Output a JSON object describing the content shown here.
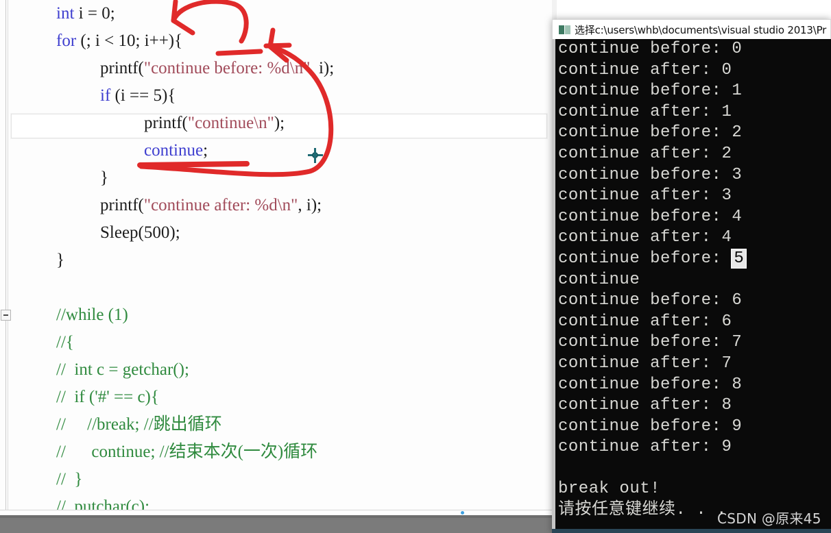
{
  "editor": {
    "name": "visual-studio-code-editor",
    "fold_marker": "−",
    "code_lines": [
      {
        "indent": 0,
        "tokens": [
          {
            "t": "int ",
            "c": "kw"
          },
          {
            "t": "i = 0;",
            "c": "pln"
          }
        ]
      },
      {
        "indent": 0,
        "tokens": [
          {
            "t": "for",
            "c": "kw"
          },
          {
            "t": " (; i < 10; i++){",
            "c": "pln"
          }
        ]
      },
      {
        "indent": 1,
        "tokens": [
          {
            "t": "printf(",
            "c": "pln"
          },
          {
            "t": "\"continue before: %d\\n\"",
            "c": "str"
          },
          {
            "t": ", i);",
            "c": "pln"
          }
        ]
      },
      {
        "indent": 1,
        "tokens": [
          {
            "t": "if",
            "c": "kw"
          },
          {
            "t": " (i == 5){",
            "c": "pln"
          }
        ]
      },
      {
        "indent": 2,
        "tokens": [
          {
            "t": "printf(",
            "c": "pln"
          },
          {
            "t": "\"continue\\n\"",
            "c": "str"
          },
          {
            "t": ");",
            "c": "pln"
          }
        ]
      },
      {
        "indent": 2,
        "tokens": [
          {
            "t": "continue",
            "c": "kw"
          },
          {
            "t": ";",
            "c": "pln"
          }
        ]
      },
      {
        "indent": 1,
        "tokens": [
          {
            "t": "}",
            "c": "pln"
          }
        ]
      },
      {
        "indent": 1,
        "tokens": [
          {
            "t": "printf(",
            "c": "pln"
          },
          {
            "t": "\"continue after: %d\\n\"",
            "c": "str"
          },
          {
            "t": ", i);",
            "c": "pln"
          }
        ]
      },
      {
        "indent": 1,
        "tokens": [
          {
            "t": "Sleep(500);",
            "c": "pln"
          }
        ]
      },
      {
        "indent": 0,
        "tokens": [
          {
            "t": "}",
            "c": "pln"
          }
        ]
      },
      {
        "indent": 0,
        "tokens": [
          {
            "t": "",
            "c": "pln"
          }
        ]
      },
      {
        "indent": 0,
        "tokens": [
          {
            "t": "//while (1)",
            "c": "cmt"
          }
        ]
      },
      {
        "indent": 0,
        "tokens": [
          {
            "t": "//{",
            "c": "cmt"
          }
        ]
      },
      {
        "indent": 0,
        "tokens": [
          {
            "t": "//  int c = getchar();",
            "c": "cmt"
          }
        ]
      },
      {
        "indent": 0,
        "tokens": [
          {
            "t": "//  if ('#' == c){",
            "c": "cmt"
          }
        ]
      },
      {
        "indent": 0,
        "tokens": [
          {
            "t": "//     //break; //跳出循环",
            "c": "cmt"
          }
        ]
      },
      {
        "indent": 0,
        "tokens": [
          {
            "t": "//      continue; //结束本次(一次)循环",
            "c": "cmt"
          }
        ]
      },
      {
        "indent": 0,
        "tokens": [
          {
            "t": "//  }",
            "c": "cmt"
          }
        ]
      },
      {
        "indent": 0,
        "tokens": [
          {
            "t": "//  putchar(c);",
            "c": "cmt"
          }
        ]
      }
    ]
  },
  "console": {
    "title": "选择c:\\users\\whb\\documents\\visual studio 2013\\Pr",
    "lines": [
      {
        "text": "continue before: 0"
      },
      {
        "text": "continue after: 0"
      },
      {
        "text": "continue before: 1"
      },
      {
        "text": "continue after: 1"
      },
      {
        "text": "continue before: 2"
      },
      {
        "text": "continue after: 2"
      },
      {
        "text": "continue before: 3"
      },
      {
        "text": "continue after: 3"
      },
      {
        "text": "continue before: 4"
      },
      {
        "text": "continue after: 4"
      },
      {
        "text": "continue before: ",
        "selected": "5"
      },
      {
        "text": "continue"
      },
      {
        "text": "continue before: 6"
      },
      {
        "text": "continue after: 6"
      },
      {
        "text": "continue before: 7"
      },
      {
        "text": "continue after: 7"
      },
      {
        "text": "continue before: 8"
      },
      {
        "text": "continue after: 8"
      },
      {
        "text": "continue before: 9"
      },
      {
        "text": "continue after: 9"
      },
      {
        "text": ""
      },
      {
        "text": "break out!"
      },
      {
        "text": "请按任意键继续. . ."
      }
    ]
  },
  "watermark": {
    "text": "CSDN @原来45"
  },
  "colors": {
    "keyword": "#3e3ecf",
    "string": "#a14b5a",
    "comment": "#2f8a3e",
    "plain": "#1d1d1d",
    "annotation_red": "#e02a2a",
    "console_bg": "#0a0a0a",
    "console_fg": "#d8d8d4",
    "crosshair": "#1f6b74"
  }
}
